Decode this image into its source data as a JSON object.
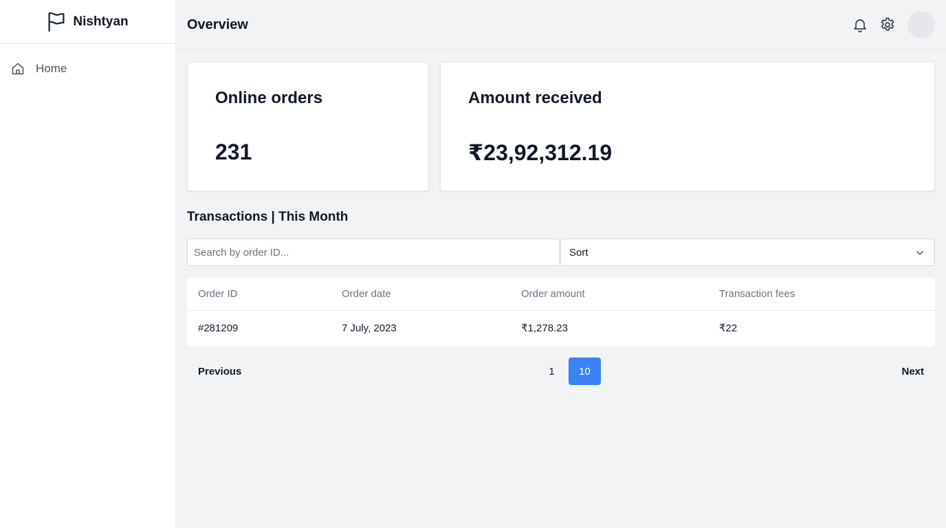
{
  "brand": {
    "name": "Nishtyan",
    "icon": "flag-icon"
  },
  "sidebar": {
    "items": [
      {
        "label": "Home",
        "icon": "home-icon"
      }
    ]
  },
  "header": {
    "title": "Overview",
    "icons": [
      "bell-icon",
      "gear-icon"
    ]
  },
  "stats": [
    {
      "title": "Online orders",
      "value": "231"
    },
    {
      "title": "Amount received",
      "value": "₹23,92,312.19"
    }
  ],
  "transactions": {
    "title": "Transactions | This Month",
    "search_placeholder": "Search by order ID...",
    "sort_label": "Sort",
    "columns": [
      "Order ID",
      "Order date",
      "Order amount",
      "Transaction fees"
    ],
    "rows": [
      [
        "#281209",
        "7 July, 2023",
        "₹1,278.23",
        "₹22"
      ]
    ]
  },
  "pagination": {
    "previous": "Previous",
    "next": "Next",
    "pages": [
      "1",
      "10"
    ],
    "active": "10"
  },
  "colors": {
    "accent": "#3b82f6",
    "background": "#f2f3f5"
  }
}
